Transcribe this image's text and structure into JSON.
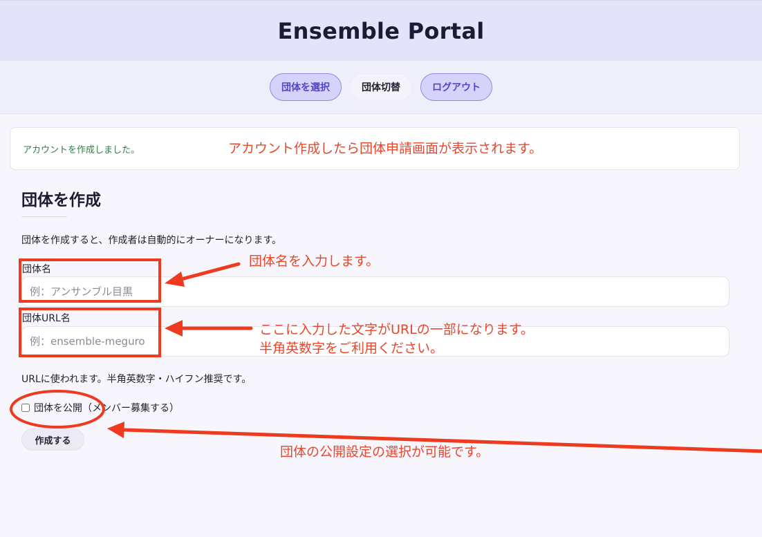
{
  "app": {
    "title": "Ensemble Portal"
  },
  "nav": {
    "select_org": "団体を選択",
    "switch_org": "団体切替",
    "logout": "ログアウト"
  },
  "notice": {
    "message": "アカウントを作成しました。"
  },
  "form": {
    "title": "団体を作成",
    "description": "団体を作成すると、作成者は自動的にオーナーになります。",
    "name_label": "団体名",
    "name_placeholder": "例：アンサンブル目黒",
    "url_label": "団体URL名",
    "url_placeholder": "例：ensemble-meguro",
    "url_help": "URLに使われます。半角英数字・ハイフン推奨です。",
    "public_label": "団体を公開（メンバー募集する）",
    "submit_label": "作成する"
  },
  "annotations": {
    "notice_note": "アカウント作成したら団体申請画面が表示されます。",
    "name_note": "団体名を入力します。",
    "url_note_line1": "ここに入力した文字がURLの一部になります。",
    "url_note_line2": "半角英数字をご利用ください。",
    "public_note": "団体の公開設定の選択が可能です。"
  },
  "colors": {
    "accent": "#4f46c9",
    "annotation": "#e8472b",
    "success": "#2e7d44"
  }
}
